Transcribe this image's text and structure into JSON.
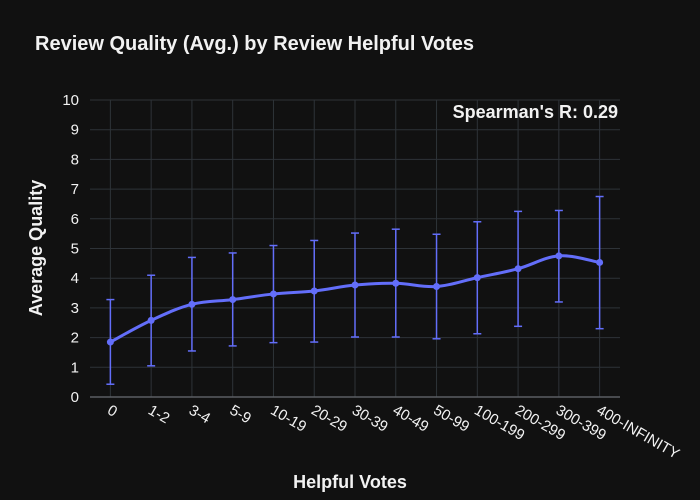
{
  "chart_data": {
    "type": "line",
    "title": "Review Quality (Avg.) by Review Helpful Votes",
    "xlabel": "Helpful Votes",
    "ylabel": "Average Quality",
    "ylim": [
      0,
      10
    ],
    "yticks": [
      "0",
      "1",
      "2",
      "3",
      "4",
      "5",
      "6",
      "7",
      "8",
      "9",
      "10"
    ],
    "grid": true,
    "annotation": "Spearman's R: 0.29",
    "colors": {
      "background": "#111111",
      "grid": "#2e3338",
      "series": "#636efa",
      "text": "#f2f2f2"
    },
    "categories": [
      "0",
      "1-2",
      "3-4",
      "5-9",
      "10-19",
      "20-29",
      "30-39",
      "40-49",
      "50-99",
      "100-199",
      "200-299",
      "300-399",
      "400-INFINITY"
    ],
    "series": [
      {
        "values": [
          1.85,
          2.58,
          3.12,
          3.28,
          3.47,
          3.57,
          3.77,
          3.83,
          3.72,
          4.02,
          4.32,
          4.75,
          4.53
        ],
        "error_low": [
          0.43,
          1.05,
          1.55,
          1.72,
          1.83,
          1.85,
          2.02,
          2.02,
          1.96,
          2.13,
          2.38,
          3.2,
          2.3
        ],
        "error_high": [
          3.28,
          4.1,
          4.7,
          4.85,
          5.1,
          5.27,
          5.52,
          5.65,
          5.48,
          5.9,
          6.25,
          6.28,
          6.75
        ]
      }
    ]
  }
}
